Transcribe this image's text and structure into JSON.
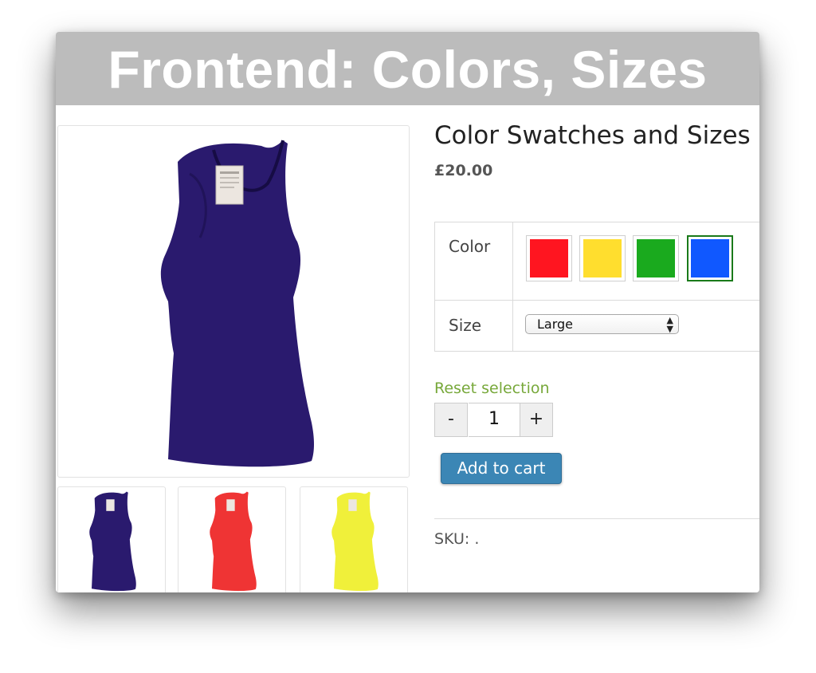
{
  "banner": {
    "title": "Frontend: Colors, Sizes"
  },
  "product": {
    "title": "Color Swatches and Sizes",
    "price": "£20.00",
    "main_image_color": "#2a1a6e",
    "thumbnails": [
      {
        "color": "#2a1a6e",
        "icon": "tank-top-navy"
      },
      {
        "color": "#ef3434",
        "icon": "tank-top-red"
      },
      {
        "color": "#f0f03a",
        "icon": "tank-top-yellow"
      }
    ]
  },
  "variations": {
    "color_label": "Color",
    "size_label": "Size",
    "swatches": [
      {
        "name": "red",
        "color": "#ff1520",
        "selected": false
      },
      {
        "name": "yellow",
        "color": "#ffde2e",
        "selected": false
      },
      {
        "name": "green",
        "color": "#1aaa1e",
        "selected": false
      },
      {
        "name": "blue",
        "color": "#1058ff",
        "selected": true
      }
    ],
    "size_selected": "Large"
  },
  "reset_label": "Reset selection",
  "quantity": {
    "minus": "-",
    "value": "1",
    "plus": "+"
  },
  "add_to_cart_label": "Add to cart",
  "sku": "SKU: .",
  "colors": {
    "accent_link": "#77a83a",
    "button": "#3b86b5",
    "banner": "#bcbcbc"
  }
}
